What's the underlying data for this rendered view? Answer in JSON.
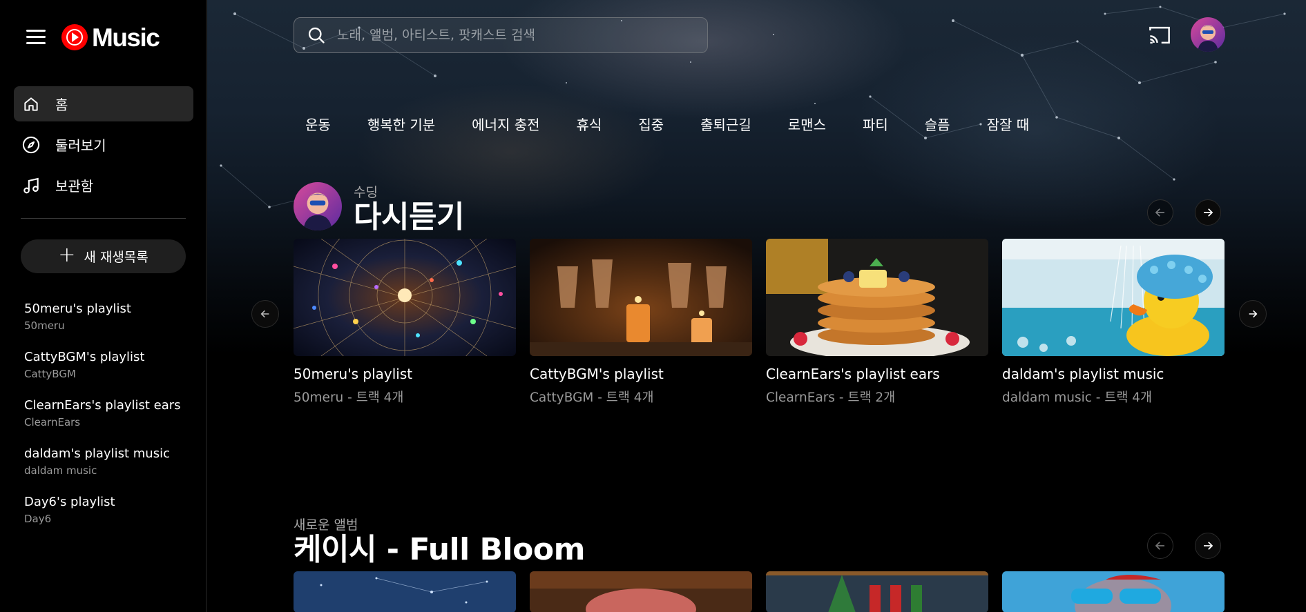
{
  "app": {
    "logo_text": "Music"
  },
  "sidebar": {
    "nav": [
      {
        "label": "홈",
        "icon": "home-icon",
        "active": true
      },
      {
        "label": "둘러보기",
        "icon": "compass-icon",
        "active": false
      },
      {
        "label": "보관함",
        "icon": "library-music-icon",
        "active": false
      }
    ],
    "new_playlist_label": "새 재생목록",
    "playlists": [
      {
        "title": "50meru's playlist",
        "owner": "50meru"
      },
      {
        "title": "CattyBGM's playlist",
        "owner": "CattyBGM"
      },
      {
        "title": "ClearnEars's playlist ears",
        "owner": "ClearnEars"
      },
      {
        "title": "daldam's playlist music",
        "owner": "daldam music"
      },
      {
        "title": "Day6's playlist",
        "owner": "Day6"
      }
    ]
  },
  "search": {
    "placeholder": "노래, 앨범, 아티스트, 팟캐스트 검색",
    "value": ""
  },
  "chips": [
    "운동",
    "행복한 기분",
    "에너지 충전",
    "휴식",
    "집중",
    "출퇴근길",
    "로맨스",
    "파티",
    "슬픔",
    "잠잘 때"
  ],
  "sections": [
    {
      "kicker": "수딩",
      "title": "다시듣기",
      "cards": [
        {
          "title": "50meru's playlist",
          "subtitle": "50meru - 트랙 4개"
        },
        {
          "title": "CattyBGM's playlist",
          "subtitle": "CattyBGM - 트랙 4개"
        },
        {
          "title": "ClearnEars's playlist ears",
          "subtitle": "ClearnEars - 트랙 2개"
        },
        {
          "title": "daldam's playlist music",
          "subtitle": "daldam music - 트랙 4개"
        }
      ]
    },
    {
      "kicker": "새로운 앨범",
      "title": "케이시 - Full Bloom"
    }
  ],
  "colors": {
    "accent": "#ff0000",
    "active_nav_bg": "#272727",
    "muted_text": "#9a9a9a"
  }
}
